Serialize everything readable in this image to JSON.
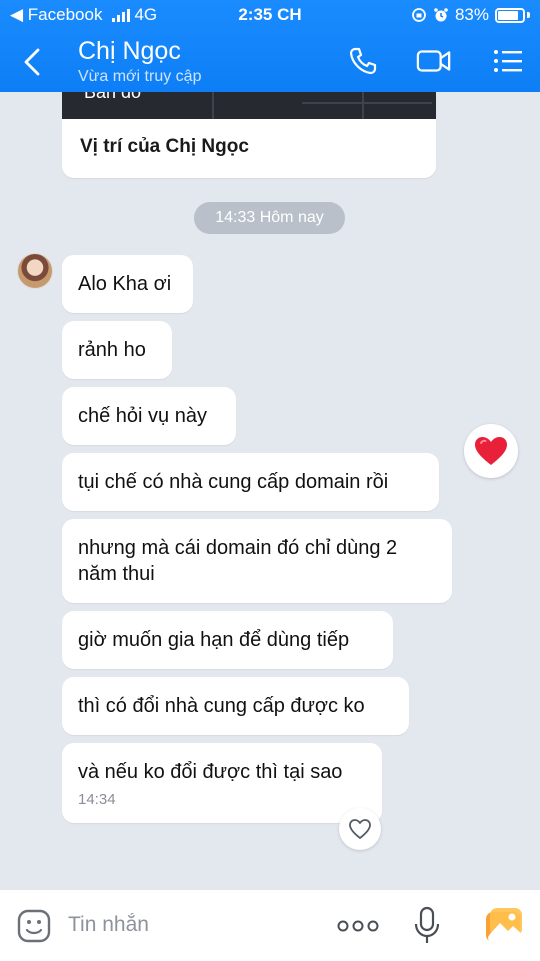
{
  "status_bar": {
    "back_app": "◀ Facebook",
    "network": "4G",
    "time": "2:35 CH",
    "battery": "83%"
  },
  "header": {
    "contact_name": "Chị Ngọc",
    "contact_status": "Vừa mới truy cập",
    "icons": [
      "back-chevron",
      "phone",
      "video-camera",
      "menu-list"
    ]
  },
  "location_card": {
    "map_label": "Bản đồ",
    "text": "Vị trí của Chị Ngọc"
  },
  "time_divider": "14:33 Hôm nay",
  "messages": [
    {
      "text": "Alo Kha ơi"
    },
    {
      "text": "rảnh ho"
    },
    {
      "text": "chế hỏi vụ này"
    },
    {
      "text": "tụi chế có nhà cung cấp domain rồi"
    },
    {
      "text": "nhưng mà cái domain đó chỉ dùng 2 năm thui"
    },
    {
      "text": "giờ muốn gia hạn để dùng tiếp"
    },
    {
      "text": "thì có đổi nhà cung cấp được ko"
    },
    {
      "text": "và nếu ko đổi được thì tại sao",
      "time": "14:34"
    }
  ],
  "reactions": {
    "heart_color": "#e8203a",
    "icons": [
      "heart-filled",
      "heart-outline"
    ]
  },
  "input_bar": {
    "placeholder": "Tin nhắn",
    "value": "",
    "icons": [
      "emoji",
      "more-dots",
      "microphone",
      "image"
    ]
  },
  "colors": {
    "header_blue": "#0d7ef5",
    "chat_bg": "#e3e7ee",
    "bubble_bg": "#ffffff",
    "image_icon_orange": "#f7a233"
  }
}
